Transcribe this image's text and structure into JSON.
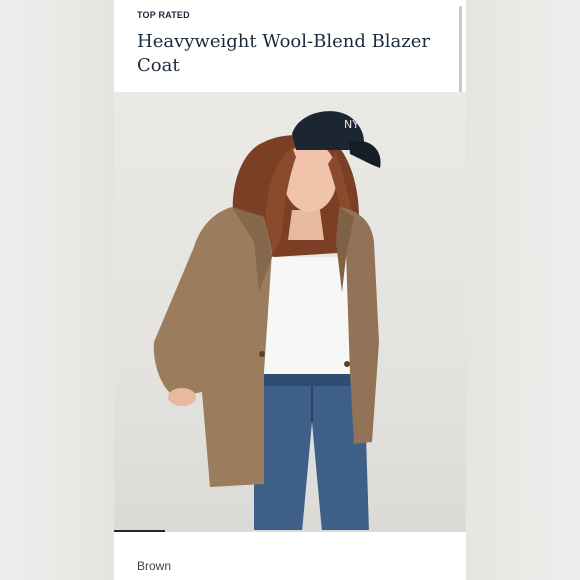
{
  "product": {
    "badge": "TOP RATED",
    "title": "Heavyweight Wool-Blend Blazer Coat"
  },
  "gallery": {
    "image_alt": "Model wearing brown wool-blend blazer coat",
    "progress_fraction": 0.145
  },
  "variant": {
    "color": "Brown"
  },
  "colors": {
    "text_primary": "#1b2a3a",
    "blazer": "#9b7d5e",
    "denim": "#3d5f88"
  },
  "icons": {
    "scrollbar": "scrollbar"
  }
}
